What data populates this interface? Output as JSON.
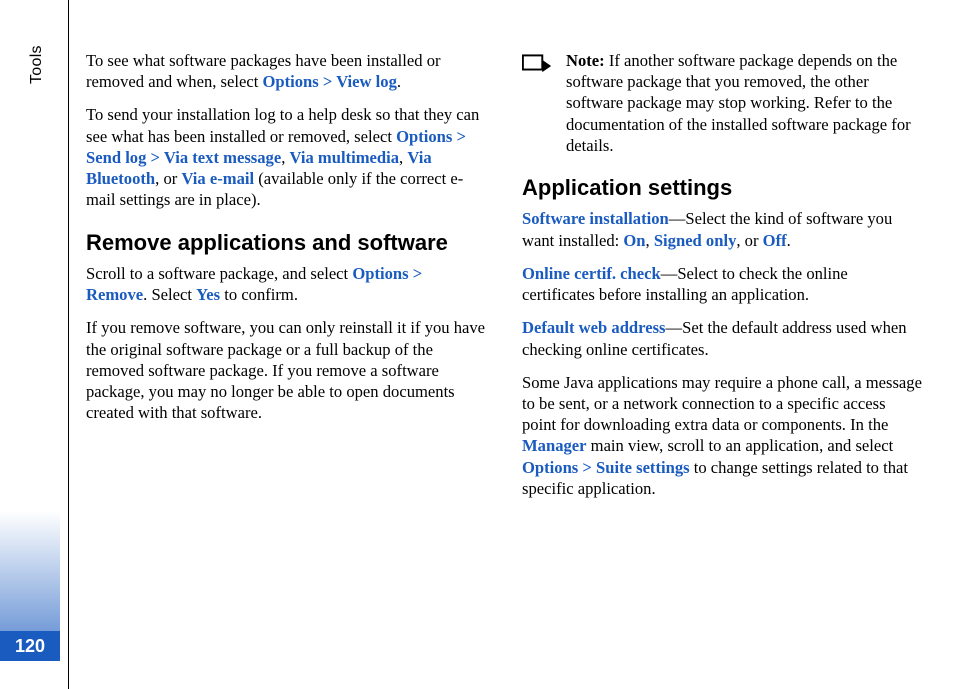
{
  "page_number": "120",
  "side_label": "Tools",
  "col1": {
    "p1_pre": "To see what software packages have been installed or removed and when, select ",
    "p1_link": "Options > View log",
    "p1_post": ".",
    "p2_pre": "To send your installation log to a help desk so that they can see what has been installed or removed, select ",
    "p2_link1": "Options > Send log > Via text message",
    "p2_sep1": ", ",
    "p2_link2": "Via multimedia",
    "p2_sep2": ", ",
    "p2_link3": "Via Bluetooth",
    "p2_sep3": ", or ",
    "p2_link4": "Via e-mail",
    "p2_post": " (available only if the correct e-mail settings are in place).",
    "h1": "Remove applications and software",
    "p3_pre": "Scroll to a software package, and select ",
    "p3_link1": "Options > Remove",
    "p3_mid": ". Select ",
    "p3_link2": "Yes",
    "p3_post": " to confirm.",
    "p4": "If you remove software, you can only reinstall it if you have the original software package or a full backup of the removed software package. If you remove a software package, you may no longer be able to open documents created with that software."
  },
  "col2": {
    "note_label": "Note:",
    "note_body": "  If another software package depends on the software package that you removed, the other software package may stop working. Refer to the documentation of the installed software package for details.",
    "h1": "Application settings",
    "p1_link": "Software installation",
    "p1_mid": "—Select the kind of software you want installed: ",
    "p1_opt1": "On",
    "p1_sep1": ", ",
    "p1_opt2": "Signed only",
    "p1_sep2": ", or ",
    "p1_opt3": "Off",
    "p1_post": ".",
    "p2_link": "Online certif. check",
    "p2_body": "—Select to check the online certificates before installing an application.",
    "p3_link": "Default web address",
    "p3_body": "—Set the default address used when checking online certificates.",
    "p4_pre": "Some Java applications may require a phone call, a message to be sent, or a network connection to a specific access point for downloading extra data or components. In the ",
    "p4_link1": "Manager",
    "p4_mid": " main view, scroll to an application, and select ",
    "p4_link2": "Options > Suite settings",
    "p4_post": " to change settings related to that specific application."
  }
}
